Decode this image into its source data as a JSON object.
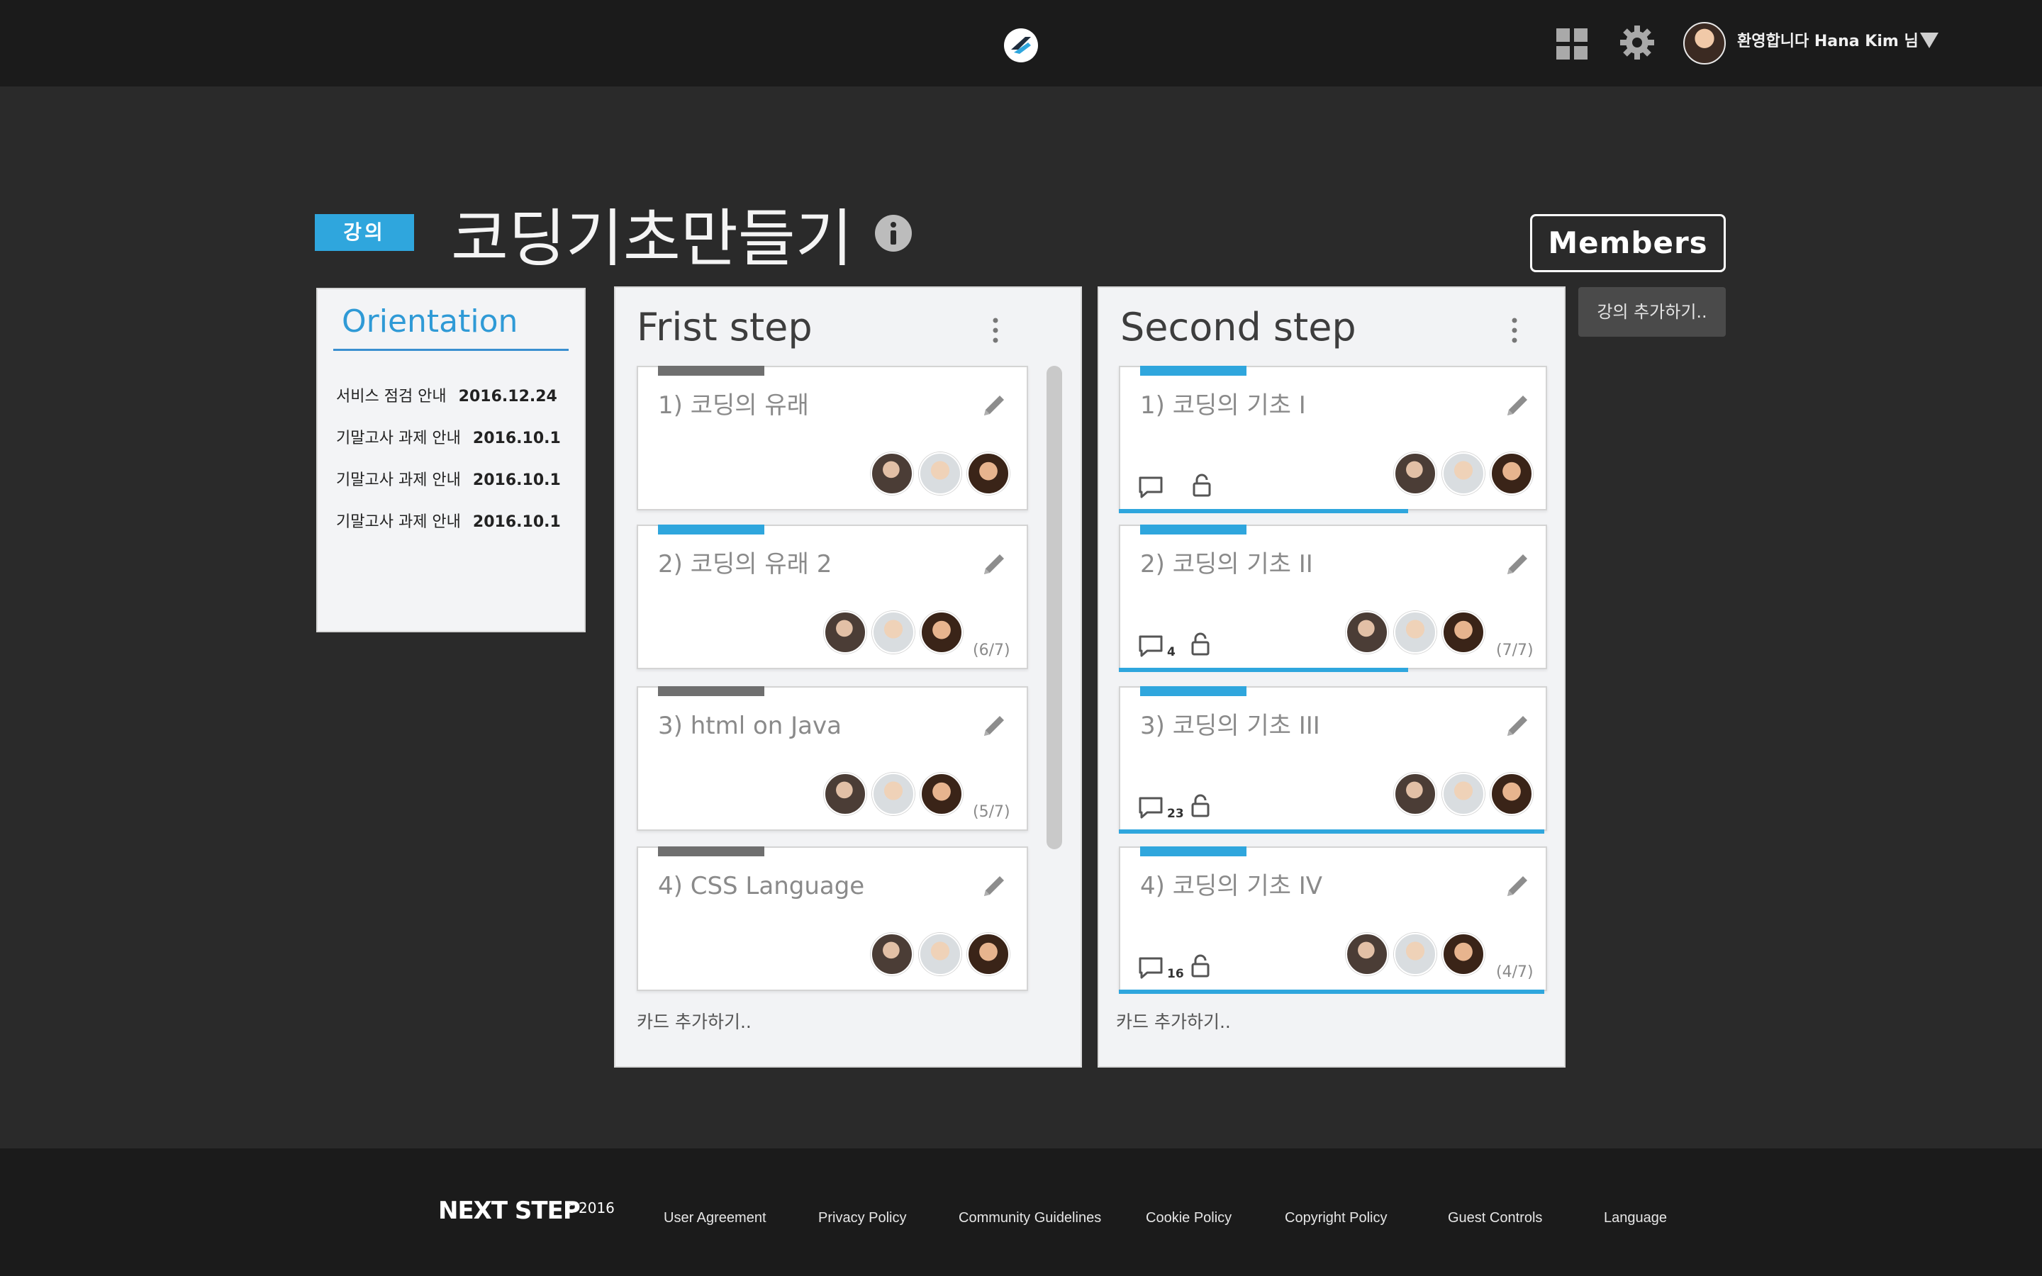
{
  "header": {
    "greeting": "환영합니다 Hana Kim 님",
    "icons": [
      "app-logo-icon",
      "apps-grid-icon",
      "gear-icon",
      "user-avatar",
      "chevron-down-icon"
    ]
  },
  "course": {
    "badge": "강의",
    "title": "코딩기초만들기",
    "members_label": "Members",
    "add_lecture_label": "강의 추가하기.."
  },
  "orientation": {
    "title": "Orientation",
    "notices": [
      {
        "text": "서비스 점검 안내",
        "date": "2016.12.24"
      },
      {
        "text": "기말고사 과제 안내",
        "date": "2016.10.1"
      },
      {
        "text": "기말고사 과제 안내",
        "date": "2016.10.1"
      },
      {
        "text": "기말고사 과제 안내",
        "date": "2016.10.1"
      }
    ]
  },
  "columns": [
    {
      "title": "Frist step",
      "add_card_label": "카드 추가하기..",
      "cards": [
        {
          "title": "1) 코딩의 유래",
          "progress": "",
          "bar_color": "#6f6f6f"
        },
        {
          "title": "2) 코딩의 유래 2",
          "progress": "(6/7)",
          "bar_color": "#2fa6dd"
        },
        {
          "title": "3) html on Java",
          "progress": "(5/7)",
          "bar_color": "#6f6f6f"
        },
        {
          "title": "4) CSS Language",
          "progress": "",
          "bar_color": "#6f6f6f"
        }
      ]
    },
    {
      "title": "Second step",
      "add_card_label": "카드 추가하기..",
      "cards": [
        {
          "title": "1) 코딩의 기초 I",
          "comments": "",
          "progress": "",
          "completion": 0.68,
          "bar_color": "#2fa6dd"
        },
        {
          "title": "2) 코딩의 기초 II",
          "comments": "4",
          "progress": "(7/7)",
          "completion": 0.68,
          "bar_color": "#2fa6dd"
        },
        {
          "title": "3) 코딩의 기초 III",
          "comments": "23",
          "progress": "",
          "completion": 1.0,
          "bar_color": "#2fa6dd"
        },
        {
          "title": "4) 코딩의 기초 IV",
          "comments": "16",
          "progress": "(4/7)",
          "completion": 1.0,
          "bar_color": "#2fa6dd"
        }
      ]
    }
  ],
  "footer": {
    "brand": "NEXT STEP",
    "copyright": "©2016",
    "links": [
      "User Agreement",
      "Privacy Policy",
      "Community Guidelines",
      "Cookie Policy",
      "Copyright Policy",
      "Guest Controls",
      "Language"
    ]
  },
  "colors": {
    "accent": "#2fa6dd",
    "header_bg": "#1b1b1b",
    "page_bg": "#2a2a2a",
    "card_bar_gray": "#6f6f6f"
  }
}
